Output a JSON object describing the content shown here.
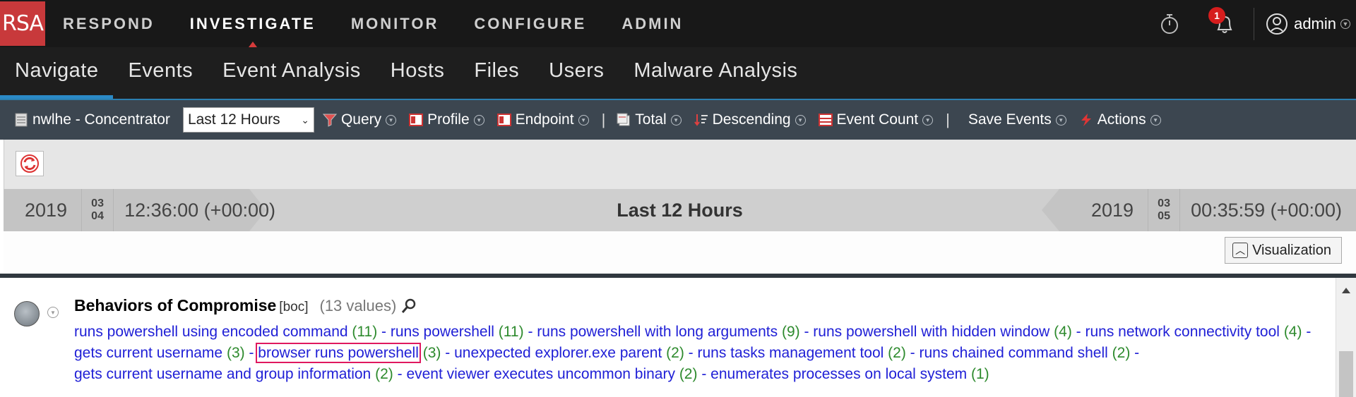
{
  "app": {
    "logo_text": "RSA"
  },
  "top_nav": {
    "items": [
      {
        "label": "RESPOND",
        "active": false
      },
      {
        "label": "INVESTIGATE",
        "active": true
      },
      {
        "label": "MONITOR",
        "active": false
      },
      {
        "label": "CONFIGURE",
        "active": false
      },
      {
        "label": "ADMIN",
        "active": false
      }
    ],
    "notification_count": "1",
    "username": "admin"
  },
  "sub_nav": {
    "items": [
      {
        "label": "Navigate",
        "active": true
      },
      {
        "label": "Events"
      },
      {
        "label": "Event Analysis"
      },
      {
        "label": "Hosts"
      },
      {
        "label": "Files"
      },
      {
        "label": "Users"
      },
      {
        "label": "Malware Analysis"
      }
    ]
  },
  "toolbar": {
    "service": "nwlhe - Concentrator",
    "time_range": "Last 12 Hours",
    "query": "Query",
    "profile": "Profile",
    "endpoint": "Endpoint",
    "total": "Total",
    "descending": "Descending",
    "event_count": "Event Count",
    "save_events": "Save Events",
    "actions": "Actions",
    "pipe": "|"
  },
  "timeline": {
    "start": {
      "year": "2019",
      "month": "03",
      "day": "04",
      "time": "12:36:00 (+00:00)"
    },
    "label": "Last 12 Hours",
    "end": {
      "year": "2019",
      "month": "03",
      "day": "05",
      "time": "00:35:59 (+00:00)"
    }
  },
  "visualization_label": "Visualization",
  "meta": {
    "title": "Behaviors of Compromise",
    "key": "[boc]",
    "count_text": "(13 values)",
    "values": [
      {
        "name": "runs powershell using encoded command",
        "count": "(11)"
      },
      {
        "name": "runs powershell",
        "count": "(11)"
      },
      {
        "name": "runs powershell with long arguments",
        "count": "(9)"
      },
      {
        "name": "runs powershell with hidden window",
        "count": "(4)"
      },
      {
        "name": "runs network connectivity tool",
        "count": "(4)"
      },
      {
        "name": "gets current username",
        "count": "(3)"
      },
      {
        "name": "browser runs powershell",
        "count": "(3)",
        "highlighted": true
      },
      {
        "name": "unexpected explorer.exe parent",
        "count": "(2)"
      },
      {
        "name": "runs tasks management tool",
        "count": "(2)"
      },
      {
        "name": "runs chained command shell",
        "count": "(2)"
      },
      {
        "name": "gets current username and group information",
        "count": "(2)"
      },
      {
        "name": "event viewer executes uncommon binary",
        "count": "(2)"
      },
      {
        "name": "enumerates processes on local system",
        "count": "(1)"
      }
    ],
    "separator": " - "
  }
}
